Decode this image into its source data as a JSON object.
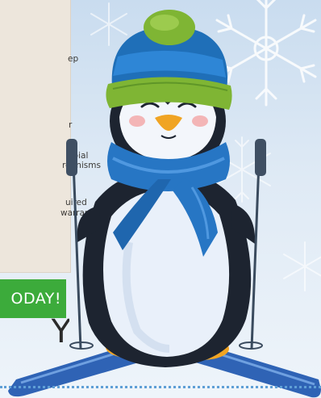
{
  "panel": {
    "lines": [
      "ep",
      "r",
      "obial",
      "rganisms",
      "uired",
      "warranty"
    ]
  },
  "cta": {
    "label": "ODAY!"
  },
  "headline_fragment": "Y",
  "colors": {
    "panel_bg": "#ede6dc",
    "cta_green": "#3cab3b",
    "hat_green": "#7fb534",
    "hat_blue": "#1f6fb8",
    "scarf_blue": "#2776c4",
    "ski_blue": "#2f63b5",
    "penguin_black": "#1d2430",
    "divider_blue": "#5f9fd6"
  },
  "illustration": {
    "subject": "penguin-on-skis",
    "icons": [
      "snowflake-icon",
      "penguin-mascot",
      "ski-pole-icon",
      "beanie-hat-icon",
      "scarf-icon"
    ]
  }
}
